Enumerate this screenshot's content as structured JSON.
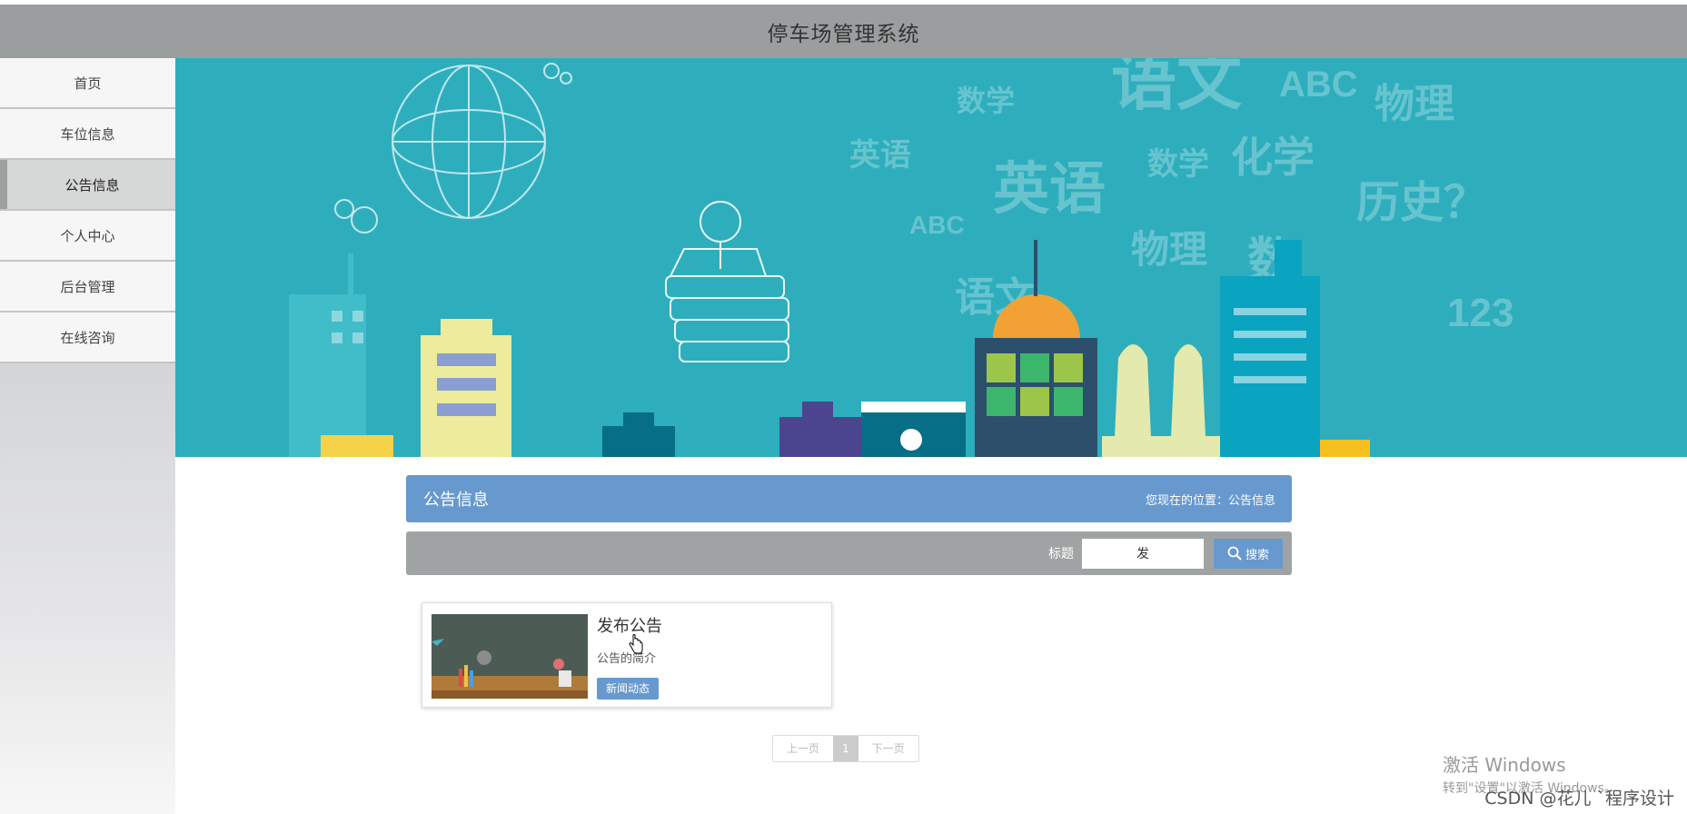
{
  "app": {
    "title": "停车场管理系统"
  },
  "sidebar": {
    "items": [
      {
        "label": "首页"
      },
      {
        "label": "车位信息"
      },
      {
        "label": "公告信息",
        "active": true
      },
      {
        "label": "个人中心"
      },
      {
        "label": "后台管理"
      },
      {
        "label": "在线咨询"
      }
    ]
  },
  "banner": {
    "words": [
      "语文",
      "ABC",
      "数学",
      "物理",
      "英语",
      "英语",
      "数学",
      "化学",
      "历史？",
      "ABC",
      "物理",
      "语文",
      "数",
      "123"
    ]
  },
  "page": {
    "title": "公告信息",
    "location": "您现在的位置：公告信息"
  },
  "search": {
    "label": "标题",
    "value": "发",
    "button_label": "搜索"
  },
  "cards": [
    {
      "title": "发布公告",
      "desc": "公告的简介",
      "tag": "新闻动态"
    }
  ],
  "pagination": {
    "prev": "上一页",
    "current": "1",
    "next": "下一页"
  },
  "watermark": {
    "line1": "激活 Windows",
    "line2": "转到\"设置\"以激活 Windows。"
  },
  "credit": "CSDN @花儿 `程序设计",
  "colors": {
    "header": "#9b9e9f",
    "accent": "#6799cf",
    "banner": "#2eaebd",
    "search_bar": "#a0a3a4"
  }
}
